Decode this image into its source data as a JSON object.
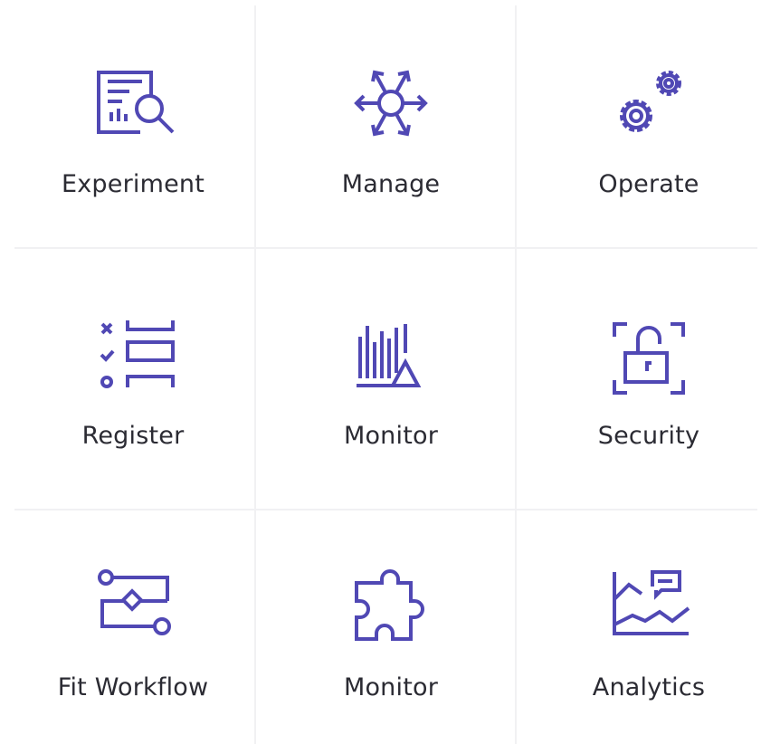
{
  "colors": {
    "accent": "#5048b4",
    "divider": "#f1f1f3",
    "text": "#2b2b33"
  },
  "tiles": [
    {
      "label": "Experiment",
      "icon": "report-search-icon"
    },
    {
      "label": "Manage",
      "icon": "hub-arrows-icon"
    },
    {
      "label": "Operate",
      "icon": "gears-icon"
    },
    {
      "label": "Register",
      "icon": "checklist-icon"
    },
    {
      "label": "Monitor",
      "icon": "bars-triangle-icon"
    },
    {
      "label": "Security",
      "icon": "unlocked-padlock-icon"
    },
    {
      "label": "Fit Workflow",
      "icon": "workflow-icon"
    },
    {
      "label": "Monitor",
      "icon": "puzzle-piece-icon"
    },
    {
      "label": "Analytics",
      "icon": "line-chart-comment-icon"
    }
  ]
}
